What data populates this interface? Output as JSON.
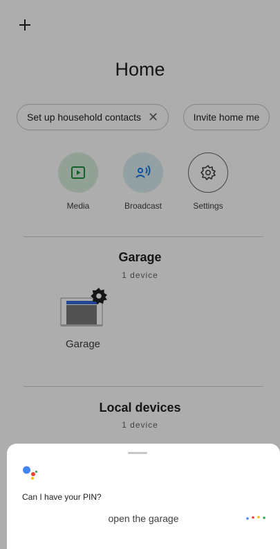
{
  "header": {
    "add_icon": "plus-icon",
    "title": "Home"
  },
  "chips": [
    {
      "label": "Set up household contacts",
      "close_icon": "close-icon",
      "close_glyph": "✕"
    },
    {
      "label": "Invite home me"
    }
  ],
  "quick_actions": [
    {
      "label": "Media",
      "icon": "play-icon",
      "bg": "#d8eede",
      "fg": "#1e8e3e"
    },
    {
      "label": "Broadcast",
      "icon": "broadcast-icon",
      "bg": "#d9eef2",
      "fg": "#1a73e8"
    },
    {
      "label": "Settings",
      "icon": "gear-icon",
      "bg": "#ffffff",
      "fg": "#3c4043"
    }
  ],
  "rooms": [
    {
      "title": "Garage",
      "count": "1 device"
    },
    {
      "title": "Local devices",
      "count": "1 device"
    }
  ],
  "devices": [
    {
      "label": "Garage",
      "icon": "garage-door-icon",
      "badge_icon": "gear-icon"
    }
  ],
  "assistant": {
    "question": "Can I have your PIN?",
    "query": "open the garage",
    "colors": {
      "blue": "#4285F4",
      "red": "#EA4335",
      "yellow": "#FBBC05",
      "green": "#34A853"
    }
  }
}
